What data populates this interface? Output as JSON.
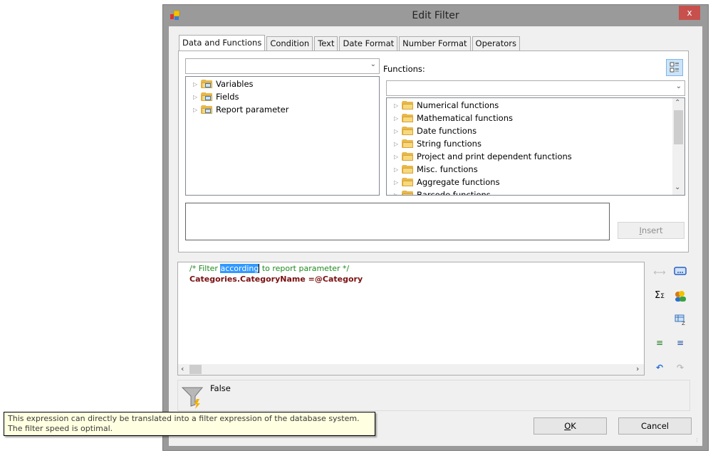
{
  "window": {
    "title": "Edit Filter",
    "close_label": "x"
  },
  "tabs": [
    {
      "label": "Data and Functions",
      "active": true
    },
    {
      "label": "Condition",
      "active": false
    },
    {
      "label": "Text",
      "active": false
    },
    {
      "label": "Date Format",
      "active": false
    },
    {
      "label": "Number Format",
      "active": false
    },
    {
      "label": "Operators",
      "active": false
    }
  ],
  "data_panel": {
    "combo_value": "",
    "tree": [
      {
        "label": "Variables",
        "icon": "variables-folder-icon"
      },
      {
        "label": "Fields",
        "icon": "fields-folder-icon"
      },
      {
        "label": "Report parameter",
        "icon": "report-parameter-folder-icon"
      }
    ]
  },
  "functions_panel": {
    "label": "Functions:",
    "combo_value": "",
    "tree": [
      {
        "label": "Numerical functions"
      },
      {
        "label": "Mathematical functions"
      },
      {
        "label": "Date functions"
      },
      {
        "label": "String functions"
      },
      {
        "label": "Project and print dependent functions"
      },
      {
        "label": "Misc. functions"
      },
      {
        "label": "Aggregate functions"
      },
      {
        "label": "Barcode functions"
      }
    ]
  },
  "description_box": "",
  "insert_button": {
    "label": "Insert",
    "mnemonic": "I",
    "rest": "nsert"
  },
  "editor": {
    "comment_before": "/* Filter ",
    "comment_selected": "according",
    "comment_after": " to report parameter */",
    "expression": "Categories.CategoryName",
    "expression_op": " =@Category"
  },
  "result": {
    "value": "False"
  },
  "tooltip": {
    "text": "This expression can directly be translated into a filter expression of the database system. The filter speed is optimal."
  },
  "buttons": {
    "ok_mnemonic": "O",
    "ok_rest": "K",
    "cancel": "Cancel"
  },
  "colors": {
    "comment": "#1f8a1f",
    "keyword": "#7a1010",
    "selection": "#3399ff",
    "close": "#c7504c",
    "tooltip_bg": "#ffffe1"
  }
}
